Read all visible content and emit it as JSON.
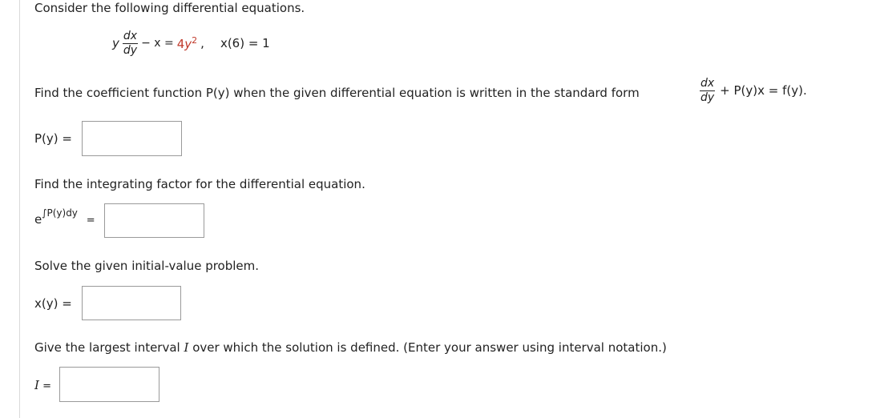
{
  "intro": "Consider the following differential equations.",
  "equation": {
    "lhs_var": "y",
    "frac_num": "dx",
    "frac_den": "dy",
    "middle": "− x = ",
    "rhs_coef": "4",
    "rhs_var": "y",
    "rhs_exp": "2",
    "comma": ",",
    "initial_condition": "x(6) = 1"
  },
  "q1": {
    "prompt": "Find the coefficient function P(y) when the given differential equation is written in the standard form",
    "std_num": "dx",
    "std_den": "dy",
    "std_rest": "+ P(y)x = f(y).",
    "label": "P(y) ="
  },
  "q2": {
    "prompt": "Find the integrating factor for the differential equation.",
    "label_base": "e",
    "label_exp": "∫P(y)dy",
    "label_eq": "="
  },
  "q3": {
    "prompt": "Solve the given initial-value problem.",
    "label": "x(y) ="
  },
  "q4": {
    "prompt_pre": "Give the largest interval ",
    "prompt_var": "I",
    "prompt_post": " over which the solution is defined. (Enter your answer using interval notation.)",
    "label_var": "I",
    "label_eq": " ="
  }
}
